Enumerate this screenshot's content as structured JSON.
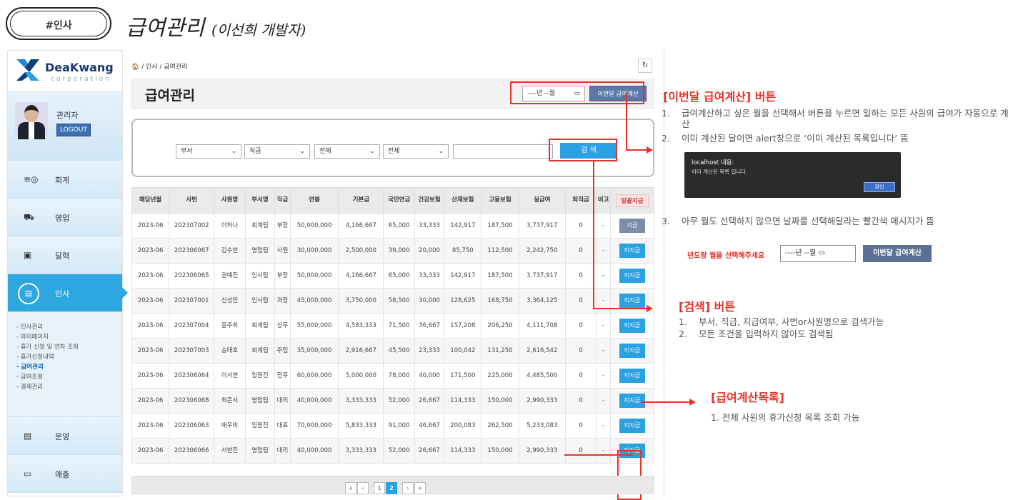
{
  "slide": {
    "tag": "#인사",
    "title": "급여관리",
    "subtitle": "(이선희 개발자)"
  },
  "sidebar": {
    "brand": "DeaKwang",
    "brand_sub": "corporation",
    "user_role": "관리자",
    "logout_label": "LOGOUT",
    "menu": [
      {
        "icon": "≡◎",
        "label": "회계"
      },
      {
        "icon": "⛟",
        "label": "영업"
      },
      {
        "icon": "▣",
        "label": "달력"
      },
      {
        "icon": "▤",
        "label": "인사",
        "active": true
      }
    ],
    "submenu": [
      "- 인사관리",
      "- 마이페이지",
      "- 휴가 신청 및 연차 조회",
      "- 휴가신청내역",
      "- 급여관리",
      "- 급여조회",
      "- 결재관리"
    ],
    "submenu_current": 4,
    "menu2": [
      {
        "icon": "▤",
        "label": "운영"
      },
      {
        "icon": "▭",
        "label": "매출"
      }
    ]
  },
  "main": {
    "breadcrumb": "🏠 / 인사 / 급여관리",
    "refresh_icon": "↻",
    "page_title": "급여관리",
    "month_placeholder": "----년 --월",
    "calendar_icon": "▭",
    "calc_button": "이번달 급여계산",
    "filters": {
      "department": "부서",
      "position": "직급",
      "status1": "전체",
      "status2": "전체",
      "search_button": "검 색"
    },
    "table": {
      "headers": [
        "해당년월",
        "사번",
        "사원명",
        "부서명",
        "직급",
        "연봉",
        "기본급",
        "국민연금",
        "건강보험",
        "산재보험",
        "고용보험",
        "실급여",
        "퇴직금",
        "비고",
        "일괄지급"
      ],
      "rows": [
        [
          "2023-06",
          "202307002",
          "이하나",
          "회계팀",
          "부장",
          "50,000,000",
          "4,166,667",
          "65,000",
          "33,333",
          "142,917",
          "187,500",
          "3,737,917",
          "0",
          "-",
          "지급"
        ],
        [
          "2023-06",
          "202306067",
          "김수한",
          "영업팀",
          "사원",
          "30,000,000",
          "2,500,000",
          "39,000",
          "20,000",
          "85,750",
          "112,500",
          "2,242,750",
          "0",
          "-",
          "미지급"
        ],
        [
          "2023-06",
          "202306065",
          "권예진",
          "인사팀",
          "부장",
          "50,000,000",
          "4,166,667",
          "65,000",
          "33,333",
          "142,917",
          "187,500",
          "3,737,917",
          "0",
          "-",
          "미지급"
        ],
        [
          "2023-06",
          "202307001",
          "신성민",
          "인사팀",
          "과장",
          "45,000,000",
          "3,750,000",
          "58,500",
          "30,000",
          "128,625",
          "168,750",
          "3,364,125",
          "0",
          "-",
          "미지급"
        ],
        [
          "2023-06",
          "202307004",
          "윤주희",
          "회계팀",
          "상무",
          "55,000,000",
          "4,583,333",
          "71,500",
          "36,667",
          "157,208",
          "206,250",
          "4,111,708",
          "0",
          "-",
          "미지급"
        ],
        [
          "2023-06",
          "202307003",
          "송태호",
          "회계팀",
          "주임",
          "35,000,000",
          "2,916,667",
          "45,500",
          "23,333",
          "100,042",
          "131,250",
          "2,616,542",
          "0",
          "-",
          "미지급"
        ],
        [
          "2023-06",
          "202306064",
          "이서연",
          "임원진",
          "전무",
          "60,000,000",
          "5,000,000",
          "78,000",
          "40,000",
          "171,500",
          "225,000",
          "4,485,500",
          "0",
          "-",
          "미지급"
        ],
        [
          "2023-06",
          "202306068",
          "최은서",
          "영업팀",
          "대리",
          "40,000,000",
          "3,333,333",
          "52,000",
          "26,667",
          "114,333",
          "150,000",
          "2,990,333",
          "0",
          "-",
          "미지급"
        ],
        [
          "2023-06",
          "202306063",
          "배우비",
          "임원진",
          "대표",
          "70,000,000",
          "5,833,333",
          "91,000",
          "46,667",
          "200,083",
          "262,500",
          "5,233,083",
          "0",
          "-",
          "미지급"
        ],
        [
          "2023-06",
          "202306066",
          "서현진",
          "영업팀",
          "대리",
          "40,000,000",
          "3,333,333",
          "52,000",
          "26,667",
          "114,333",
          "150,000",
          "2,990,333",
          "0",
          "-",
          "미지급"
        ]
      ]
    },
    "pager": [
      "«",
      "‹",
      "1",
      "2",
      "›",
      "»"
    ],
    "pager_current": "2"
  },
  "annotations": {
    "calc": {
      "heading": "[이번달 급여계산] 버튼",
      "items": [
        {
          "num": "1.",
          "text": "급여계산하고 싶은 월을 선택해서 버튼을 누르면 일하는 모든 사원의 급여가 자동으로 계산"
        },
        {
          "num": "2.",
          "text": "이미 계산된 달이면 alert창으로 ‘이미 계산된 목록입니다’ 뜸"
        }
      ],
      "alert_title": "localhost 내용:",
      "alert_text": "이미 계산된 목록 입니다.",
      "alert_ok": "확인",
      "item3_num": "3.",
      "item3": "아무 월도 선택하지 않으면 날짜를 선택해달라는 빨간색 메시지가 뜸",
      "err_msg": "년도랑 월을 선택해주세요",
      "err_input": "----년 --월",
      "err_button": "이번달 급여계산"
    },
    "search": {
      "heading": "[검색] 버튼",
      "items": [
        {
          "num": "1.",
          "text": "부서, 직급, 지급여부, 사번or사원명으로 검색가능"
        },
        {
          "num": "2.",
          "text": "모든 조건을 입력하지 않아도 검색됨"
        }
      ]
    },
    "list": {
      "heading": "[급여계산목록]",
      "item": "1. 전체 사원의 휴가신청 목록 조회 가능"
    }
  },
  "colors": {
    "accent": "#2aa1e0",
    "annotation_red": "#e6332a",
    "brand": "#1a3b6e"
  }
}
